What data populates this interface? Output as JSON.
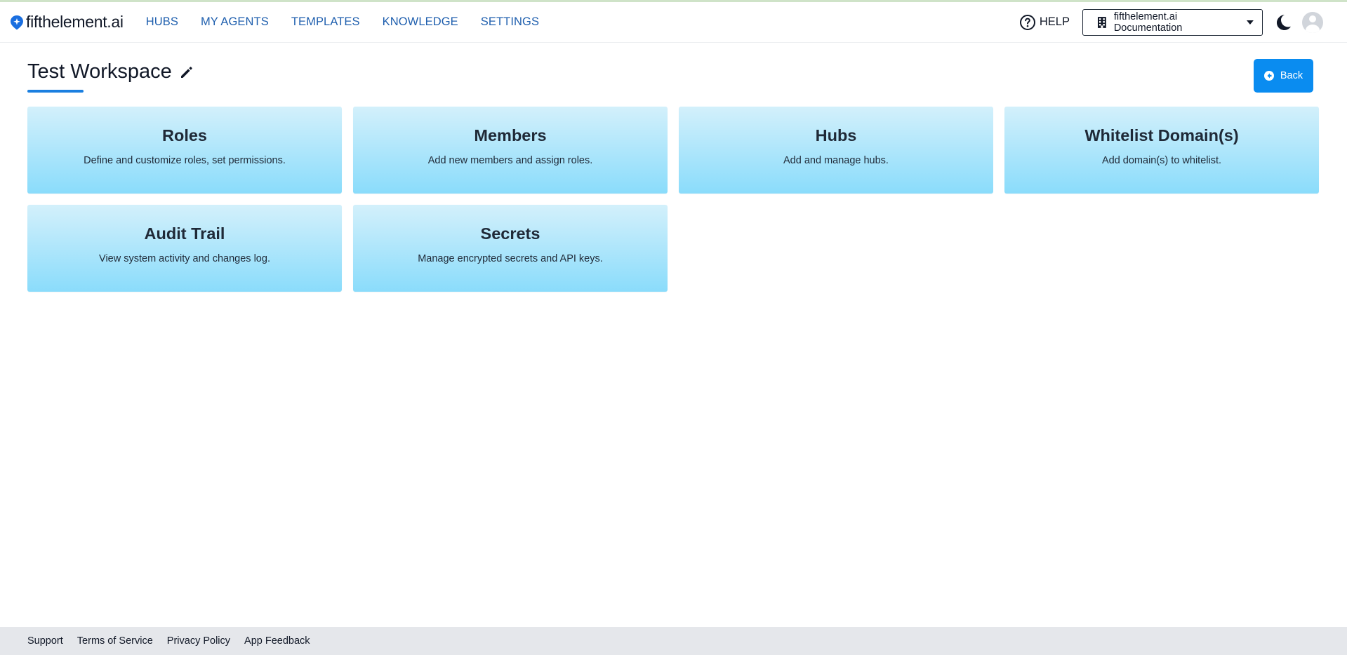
{
  "brand": {
    "name": "fifthelement.ai",
    "logo_icon": "sparkle-pin-icon",
    "accent": "#1a6fe0"
  },
  "nav": {
    "items": [
      {
        "label": "HUBS"
      },
      {
        "label": "MY AGENTS"
      },
      {
        "label": "TEMPLATES"
      },
      {
        "label": "KNOWLEDGE"
      },
      {
        "label": "SETTINGS"
      }
    ],
    "color": "#1f5fae"
  },
  "header": {
    "help_label": "HELP",
    "org_selector": {
      "value": "fifthelement.ai Documentation",
      "icon": "building-icon"
    },
    "theme_toggle_icon": "moon-icon",
    "avatar_icon": "user-avatar-icon"
  },
  "page": {
    "title": "Test Workspace",
    "edit_icon": "pencil-icon",
    "back_label": "Back",
    "back_color": "#0a8cf0"
  },
  "cards": [
    {
      "title": "Roles",
      "description": "Define and customize roles, set permissions."
    },
    {
      "title": "Members",
      "description": "Add new members and assign roles."
    },
    {
      "title": "Hubs",
      "description": "Add and manage hubs."
    },
    {
      "title": "Whitelist Domain(s)",
      "description": "Add domain(s) to whitelist."
    },
    {
      "title": "Audit Trail",
      "description": "View system activity and changes log."
    },
    {
      "title": "Secrets",
      "description": "Manage encrypted secrets and API keys."
    }
  ],
  "footer": {
    "links": [
      {
        "label": "Support"
      },
      {
        "label": "Terms of Service"
      },
      {
        "label": "Privacy Policy"
      },
      {
        "label": "App Feedback"
      }
    ]
  }
}
